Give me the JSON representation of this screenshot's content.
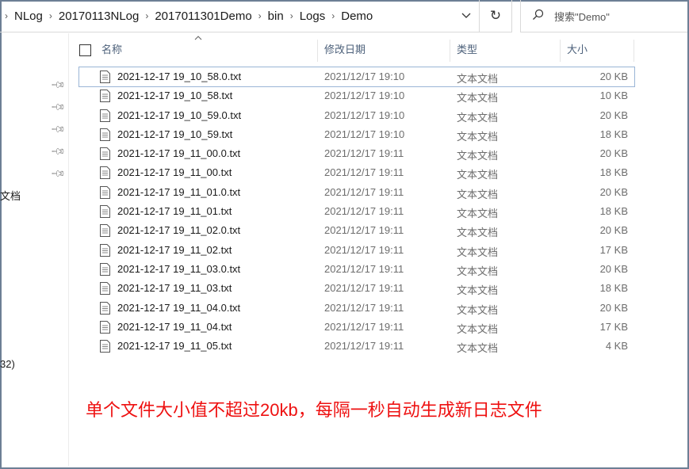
{
  "breadcrumb": [
    "NLog",
    "20170113NLog",
    "2017011301Demo",
    "bin",
    "Logs",
    "Demo"
  ],
  "search": {
    "placeholder": "搜索\"Demo\""
  },
  "icons": {
    "dropdown": "chevron-down-icon",
    "refresh": "refresh-icon",
    "search": "search-icon",
    "pin": "pin-icon",
    "file": "text-file-icon"
  },
  "nav": {
    "partial_doc_label": "文档",
    "partial_label_2": "32)"
  },
  "columns": {
    "name": "名称",
    "date": "修改日期",
    "type": "类型",
    "size": "大小"
  },
  "files": [
    {
      "name": "2021-12-17 19_10_58.0.txt",
      "date": "2021/12/17 19:10",
      "type": "文本文档",
      "size": "20 KB"
    },
    {
      "name": "2021-12-17 19_10_58.txt",
      "date": "2021/12/17 19:10",
      "type": "文本文档",
      "size": "10 KB"
    },
    {
      "name": "2021-12-17 19_10_59.0.txt",
      "date": "2021/12/17 19:10",
      "type": "文本文档",
      "size": "20 KB"
    },
    {
      "name": "2021-12-17 19_10_59.txt",
      "date": "2021/12/17 19:10",
      "type": "文本文档",
      "size": "18 KB"
    },
    {
      "name": "2021-12-17 19_11_00.0.txt",
      "date": "2021/12/17 19:11",
      "type": "文本文档",
      "size": "20 KB"
    },
    {
      "name": "2021-12-17 19_11_00.txt",
      "date": "2021/12/17 19:11",
      "type": "文本文档",
      "size": "18 KB"
    },
    {
      "name": "2021-12-17 19_11_01.0.txt",
      "date": "2021/12/17 19:11",
      "type": "文本文档",
      "size": "20 KB"
    },
    {
      "name": "2021-12-17 19_11_01.txt",
      "date": "2021/12/17 19:11",
      "type": "文本文档",
      "size": "18 KB"
    },
    {
      "name": "2021-12-17 19_11_02.0.txt",
      "date": "2021/12/17 19:11",
      "type": "文本文档",
      "size": "20 KB"
    },
    {
      "name": "2021-12-17 19_11_02.txt",
      "date": "2021/12/17 19:11",
      "type": "文本文档",
      "size": "17 KB"
    },
    {
      "name": "2021-12-17 19_11_03.0.txt",
      "date": "2021/12/17 19:11",
      "type": "文本文档",
      "size": "20 KB"
    },
    {
      "name": "2021-12-17 19_11_03.txt",
      "date": "2021/12/17 19:11",
      "type": "文本文档",
      "size": "18 KB"
    },
    {
      "name": "2021-12-17 19_11_04.0.txt",
      "date": "2021/12/17 19:11",
      "type": "文本文档",
      "size": "20 KB"
    },
    {
      "name": "2021-12-17 19_11_04.txt",
      "date": "2021/12/17 19:11",
      "type": "文本文档",
      "size": "17 KB"
    },
    {
      "name": "2021-12-17 19_11_05.txt",
      "date": "2021/12/17 19:11",
      "type": "文本文档",
      "size": "4 KB"
    }
  ],
  "annotation": "单个文件大小值不超过20kb，每隔一秒自动生成新日志文件",
  "colors": {
    "annotation": "#ee1111",
    "header_text": "#4c607a",
    "frame": "#6d7f95"
  }
}
